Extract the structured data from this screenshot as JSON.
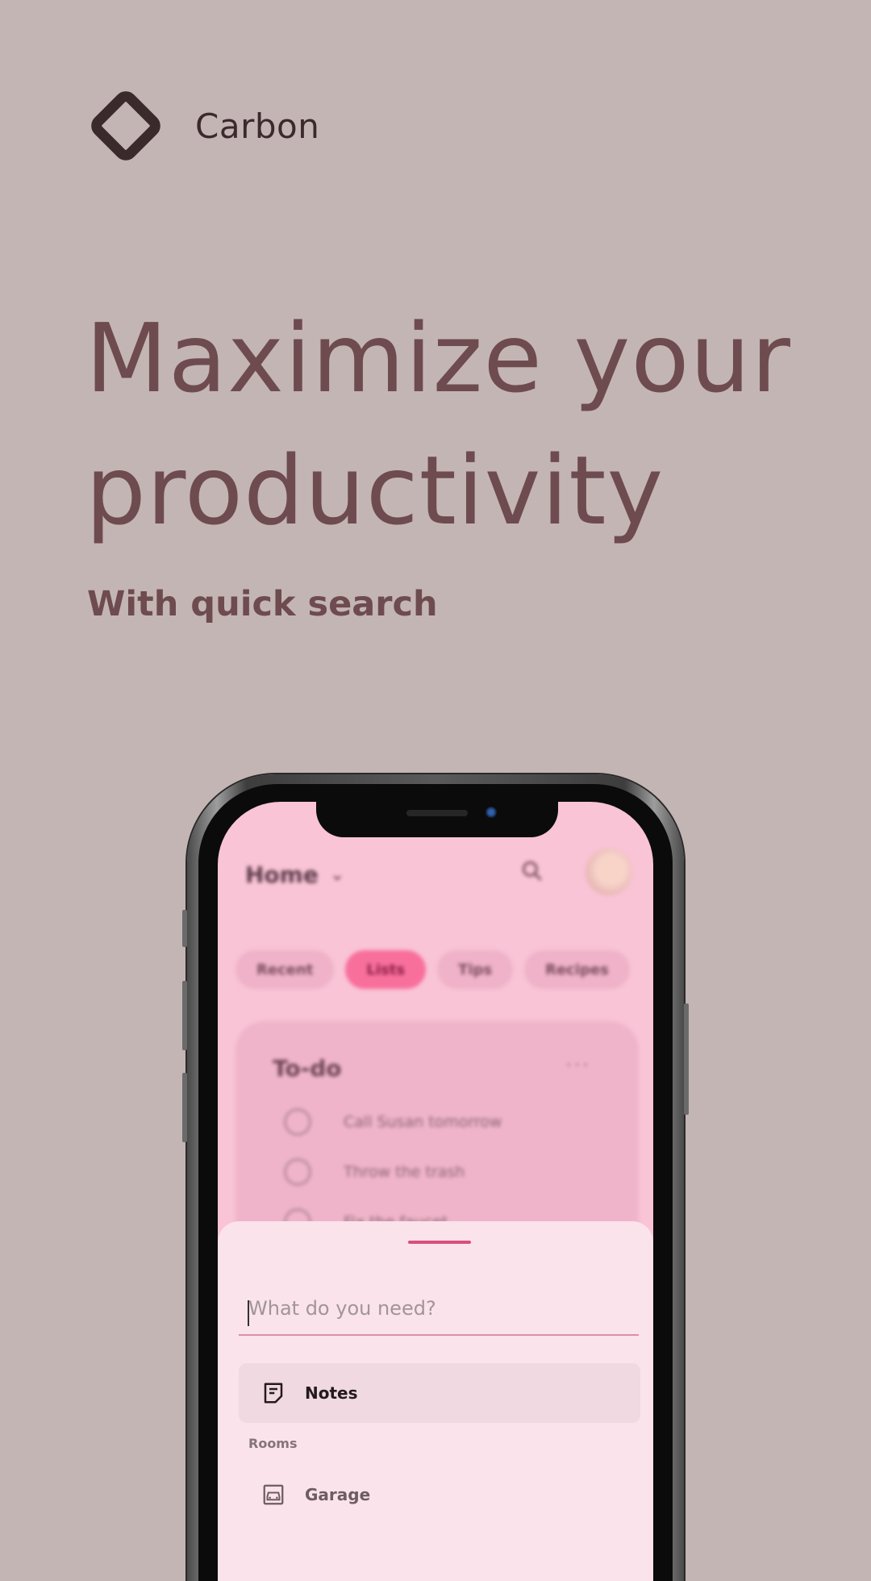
{
  "brand": {
    "name": "Carbon",
    "logo_icon": "diamond-logo-icon"
  },
  "hero": {
    "line1": "Maximize your",
    "line2": "productivity",
    "subtitle": "With quick search"
  },
  "colors": {
    "background": "#c3b5b4",
    "headline": "#6e4b4f",
    "accent": "#d94f7c",
    "screen": "#f9c4d6",
    "sheet": "#fae3eb"
  },
  "app": {
    "title": "Home",
    "header_icons": [
      "chevron-down-icon",
      "search-icon",
      "avatar"
    ],
    "tabs": [
      {
        "label": "Recent",
        "active": false
      },
      {
        "label": "Lists",
        "active": true
      },
      {
        "label": "Tips",
        "active": false
      },
      {
        "label": "Recipes",
        "active": false
      }
    ],
    "todo": {
      "title": "To-do",
      "more": "···",
      "items": [
        "Call Susan tomorrow",
        "Throw the trash",
        "Fix the faucet"
      ]
    }
  },
  "sheet": {
    "search_placeholder": "What do you need?",
    "results": [
      {
        "label": "Notes",
        "icon": "note-icon"
      }
    ],
    "section": "Rooms",
    "rooms": [
      {
        "label": "Garage",
        "icon": "garage-icon"
      }
    ]
  }
}
